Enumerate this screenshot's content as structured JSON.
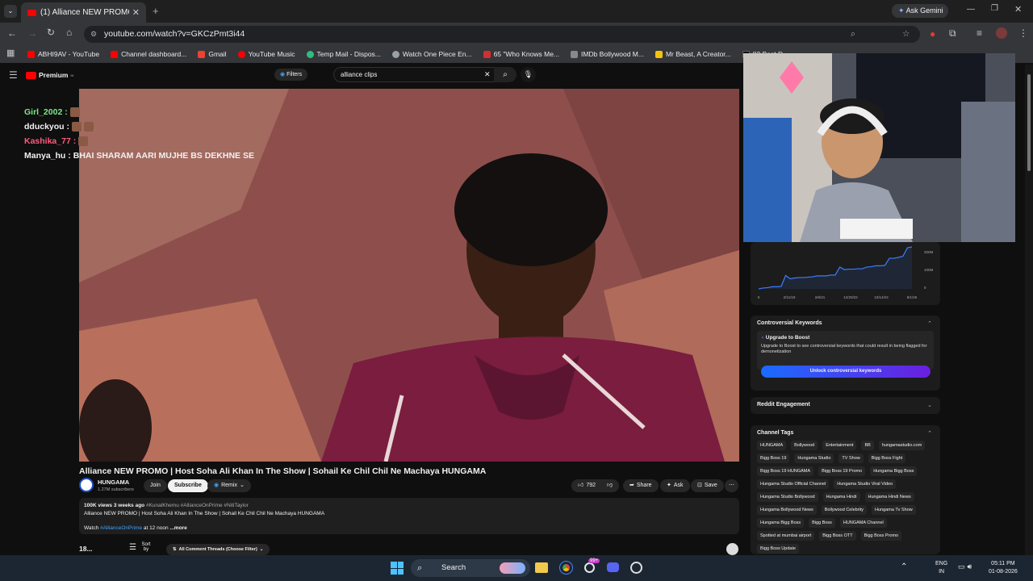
{
  "browser": {
    "tab_title": "(1) Alliance NEW PROMO | Host",
    "url": "youtube.com/watch?v=GKCzPmt3i44",
    "ask_gemini": "Ask Gemini",
    "bookmarks": [
      {
        "label": "ABHI9AV - YouTube",
        "color": "#ff0000"
      },
      {
        "label": "Channel dashboard...",
        "color": "#ff0000"
      },
      {
        "label": "Gmail",
        "color": "#ea4335"
      },
      {
        "label": "YouTube Music",
        "color": "#ff0000"
      },
      {
        "label": "Temp Mail - Dispos...",
        "color": "#2ebd7e"
      },
      {
        "label": "Watch One Piece En...",
        "color": "#9aa0a6"
      },
      {
        "label": "65 \"Who Knows Me...",
        "color": "#d32f2f"
      },
      {
        "label": "IMDb Bollywood M...",
        "color": "#888888"
      },
      {
        "label": "Mr Beast, A Creator...",
        "color": "#f4c20d"
      },
      {
        "label": "83 Best D...",
        "color": "#000000"
      }
    ]
  },
  "youtube": {
    "logo": "Premium",
    "logo_sup": "IN",
    "filters": "Filters",
    "search_query": "alliance clips",
    "chat": [
      {
        "user": "Girl_2002 :",
        "color": "#7ee787",
        "msg": ""
      },
      {
        "user": "dduckyou :",
        "color": "#f1f1f1",
        "msg": ""
      },
      {
        "user": "Kashika_77 :",
        "color": "#ff5b7f",
        "msg": ""
      },
      {
        "user": "Manya_hu :",
        "color": "#f1f1f1",
        "msg": "BHAI SHARAM AARI MUJHE BS DEKHNE SE"
      }
    ],
    "video_title": "Alliance NEW PROMO | Host Soha Ali Khan In The Show | Sohail Ke Chil Chil Ne Machaya HUNGAMA",
    "channel": "HUNGAMA",
    "subscribers": "1.27M subscribers",
    "join": "Join",
    "subscribe": "Subscribe",
    "remix": "Remix",
    "likes": "792",
    "share": "Share",
    "ask": "Ask",
    "save": "Save",
    "desc_meta": "100K views  3 weeks ago",
    "desc_tags": "#KunalKhemu #AllianceOnPrime #NitiTaylor",
    "desc_line": "Alliance NEW PROMO | Host Soha Ali Khan In The Show | Sohail Ke Chil Chil Ne Machaya HUNGAMA",
    "desc_watch": "Watch",
    "desc_link": "#AllianceOnPrime",
    "desc_after": "at 12 noon",
    "desc_more": "...more",
    "comments_count": "18...",
    "sort_by": "Sort by",
    "comment_filter": "All Comment Threads (Choose Filter)"
  },
  "sidebar": {
    "chart_data": {
      "type": "line",
      "x_ticks": [
        "0",
        "2/11/19",
        "2/6/21",
        "12/20/22",
        "10/14/24",
        "8/1/26"
      ],
      "y_ticks": [
        "200M",
        "100M",
        "0"
      ],
      "values": [
        0,
        2,
        3,
        5,
        5,
        6,
        32,
        24,
        26,
        27,
        27,
        28,
        29,
        31,
        31,
        31,
        33,
        33,
        52,
        46,
        47,
        47,
        48,
        48,
        52,
        53,
        55,
        55,
        56,
        73,
        73,
        75,
        78,
        98,
        100
      ]
    },
    "controversial": {
      "title": "Controversial Keywords",
      "upgrade_title": "Upgrade to Boost",
      "upgrade_text": "Upgrade to Boost to see controversial keywords that could result in being flagged for demonetization",
      "button": "Unlock controversial keywords"
    },
    "reddit": "Reddit Engagement",
    "channel_tags_title": "Channel Tags",
    "tags": [
      "HUNGAMA",
      "Bollywood",
      "Entertainment",
      "BB",
      "hungamastudio.com",
      "Bigg Boss 19",
      "Hungama Studio",
      "TV Show",
      "Bigg Boss Fight",
      "Bigg Boss 19 HUNGAMA",
      "Bigg Boss 19 Promo",
      "Hungama Bigg Boss",
      "Hungama Studio Official Channel",
      "Hungama Studio Viral Video",
      "Hungama Studio Bollywood",
      "Hungama Hindi",
      "Hungama Hindi News",
      "Hungama Bollywood News",
      "Bollywood Celebrity",
      "Hungama Tv Show",
      "Hungama Bigg Boss",
      "Bigg Boss",
      "HUNGAMA Channel",
      "Spotted at mumbai airport",
      "Bigg Boss OTT",
      "Bigg Boss Promo",
      "Bigg Boss Update"
    ]
  },
  "taskbar": {
    "search": "Search",
    "badge": "99+",
    "lang1": "ENG",
    "lang2": "IN",
    "time": "05:11 PM",
    "date": "01-08-2026"
  }
}
